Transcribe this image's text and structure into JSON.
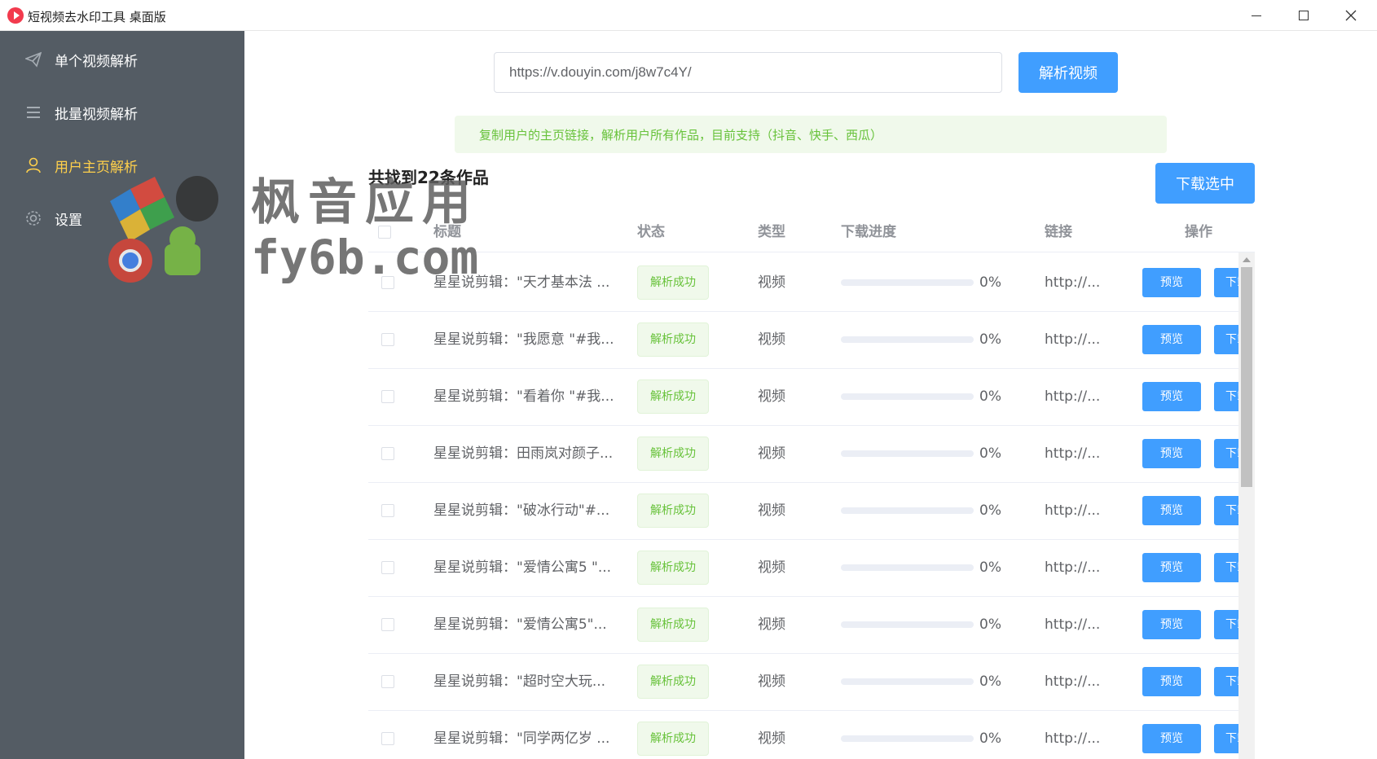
{
  "window": {
    "title": "短视频去水印工具 桌面版"
  },
  "sidebar": {
    "items": [
      {
        "label": "单个视频解析",
        "icon": "paper-plane-icon"
      },
      {
        "label": "批量视频解析",
        "icon": "list-icon"
      },
      {
        "label": "用户主页解析",
        "icon": "user-icon",
        "active": true
      },
      {
        "label": "设置",
        "icon": "gear-icon"
      }
    ]
  },
  "search": {
    "value": "https://v.douyin.com/j8w7c4Y/",
    "button_label": "解析视频"
  },
  "tip": "复制用户的主页链接，解析用户所有作品，目前支持（抖音、快手、西瓜）",
  "result_summary": "共找到22条作品",
  "download_selected_label": "下载选中",
  "table": {
    "headers": {
      "title": "标题",
      "status": "状态",
      "type": "类型",
      "progress": "下载进度",
      "link": "链接",
      "action": "操作"
    },
    "rows": [
      {
        "title": "星星说剪辑：\"天才基本法 ...",
        "status": "解析成功",
        "type": "视频",
        "progress": 0,
        "progress_label": "0%",
        "link": "http://...",
        "preview": "预览",
        "download": "下载"
      },
      {
        "title": "星星说剪辑：\"我愿意 \"#我...",
        "status": "解析成功",
        "type": "视频",
        "progress": 0,
        "progress_label": "0%",
        "link": "http://...",
        "preview": "预览",
        "download": "下载"
      },
      {
        "title": "星星说剪辑：\"看着你 \"#我...",
        "status": "解析成功",
        "type": "视频",
        "progress": 0,
        "progress_label": "0%",
        "link": "http://...",
        "preview": "预览",
        "download": "下载"
      },
      {
        "title": "星星说剪辑：田雨岚对颜子...",
        "status": "解析成功",
        "type": "视频",
        "progress": 0,
        "progress_label": "0%",
        "link": "http://...",
        "preview": "预览",
        "download": "下载"
      },
      {
        "title": "星星说剪辑：\"破冰行动\"#...",
        "status": "解析成功",
        "type": "视频",
        "progress": 0,
        "progress_label": "0%",
        "link": "http://...",
        "preview": "预览",
        "download": "下载"
      },
      {
        "title": "星星说剪辑：\"爱情公寓5 \"...",
        "status": "解析成功",
        "type": "视频",
        "progress": 0,
        "progress_label": "0%",
        "link": "http://...",
        "preview": "预览",
        "download": "下载"
      },
      {
        "title": "星星说剪辑：\"爱情公寓5\"...",
        "status": "解析成功",
        "type": "视频",
        "progress": 0,
        "progress_label": "0%",
        "link": "http://...",
        "preview": "预览",
        "download": "下载"
      },
      {
        "title": "星星说剪辑：\"超时空大玩...",
        "status": "解析成功",
        "type": "视频",
        "progress": 0,
        "progress_label": "0%",
        "link": "http://...",
        "preview": "预览",
        "download": "下载"
      },
      {
        "title": "星星说剪辑：\"同学两亿岁 ...",
        "status": "解析成功",
        "type": "视频",
        "progress": 0,
        "progress_label": "0%",
        "link": "http://...",
        "preview": "预览",
        "download": "下载"
      }
    ]
  },
  "watermark": {
    "line1": "枫音应用",
    "line2": "fy6b.com"
  },
  "colors": {
    "sidebar_bg": "#545c64",
    "active_nav": "#ffd04b",
    "primary": "#409eff",
    "success": "#67c23a",
    "success_bg": "#f0f9eb"
  }
}
